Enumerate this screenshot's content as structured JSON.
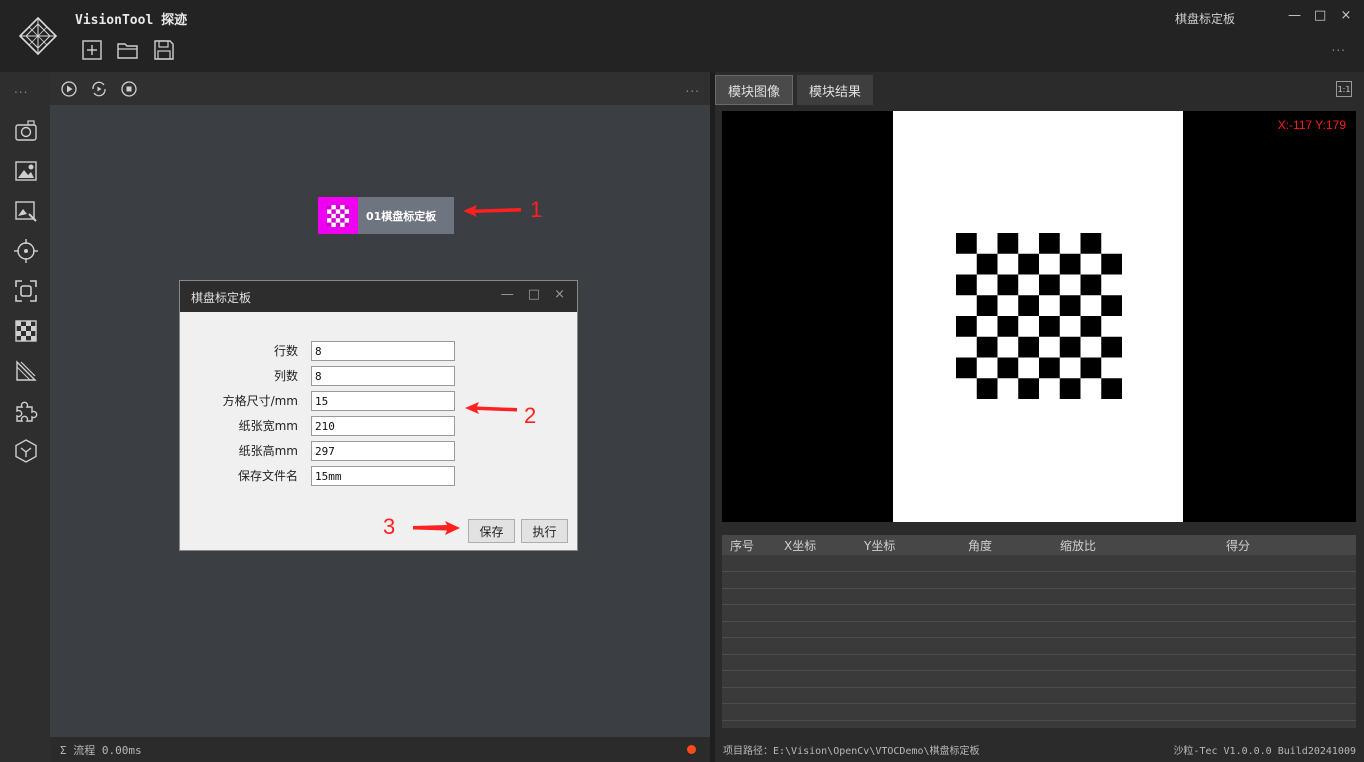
{
  "app": {
    "title": "VisionTool 探迹",
    "window_title": "棋盘标定板",
    "minimize_glyph": "—",
    "maximize_glyph": "□",
    "close_glyph": "×",
    "more_glyph": "..."
  },
  "toolbar": {
    "icons": [
      "new-file-icon",
      "open-folder-icon",
      "save-icon"
    ]
  },
  "sidebar": {
    "more_glyph": "...",
    "icons": [
      "camera-icon",
      "image-settings-icon",
      "image-edit-icon",
      "crosshair-icon",
      "focus-frame-icon",
      "checkerboard-icon",
      "ruler-icon",
      "puzzle-icon",
      "hexagon-icon"
    ]
  },
  "flow": {
    "controls": [
      "play-icon",
      "loop-run-icon",
      "stop-icon"
    ],
    "more_glyph": "...",
    "node_label": "01棋盘标定板",
    "status_text": "Σ  流程 0.00ms",
    "status_color": "#ff4a1a"
  },
  "annotations": {
    "a1": "1",
    "a2": "2",
    "a3": "3",
    "color": "#ff2020"
  },
  "dialog": {
    "title": "棋盘标定板",
    "minimize_glyph": "—",
    "maximize_glyph": "□",
    "close_glyph": "×",
    "fields": [
      {
        "label": "行数",
        "value": "8"
      },
      {
        "label": "列数",
        "value": "8"
      },
      {
        "label": "方格尺寸/mm",
        "value": "15"
      },
      {
        "label": "纸张宽mm",
        "value": "210"
      },
      {
        "label": "纸张高mm",
        "value": "297"
      },
      {
        "label": "保存文件名",
        "value": "15mm"
      }
    ],
    "save_label": "保存",
    "run_label": "执行"
  },
  "right": {
    "tabs": [
      "模块图像",
      "模块结果"
    ],
    "active_tab": 0,
    "zoom_label": "1:1",
    "coord_text": "X:-117 Y:179",
    "coord_color": "#ff1a1a",
    "columns": [
      "序号",
      "X坐标",
      "Y坐标",
      "角度",
      "缩放比",
      "得分"
    ],
    "rows": [],
    "path_text": "项目路径：E:\\Vision\\OpenCv\\VTOCDemo\\棋盘标定板",
    "version_text": "沙粒-Tec V1.0.0.0 Build20241009"
  }
}
